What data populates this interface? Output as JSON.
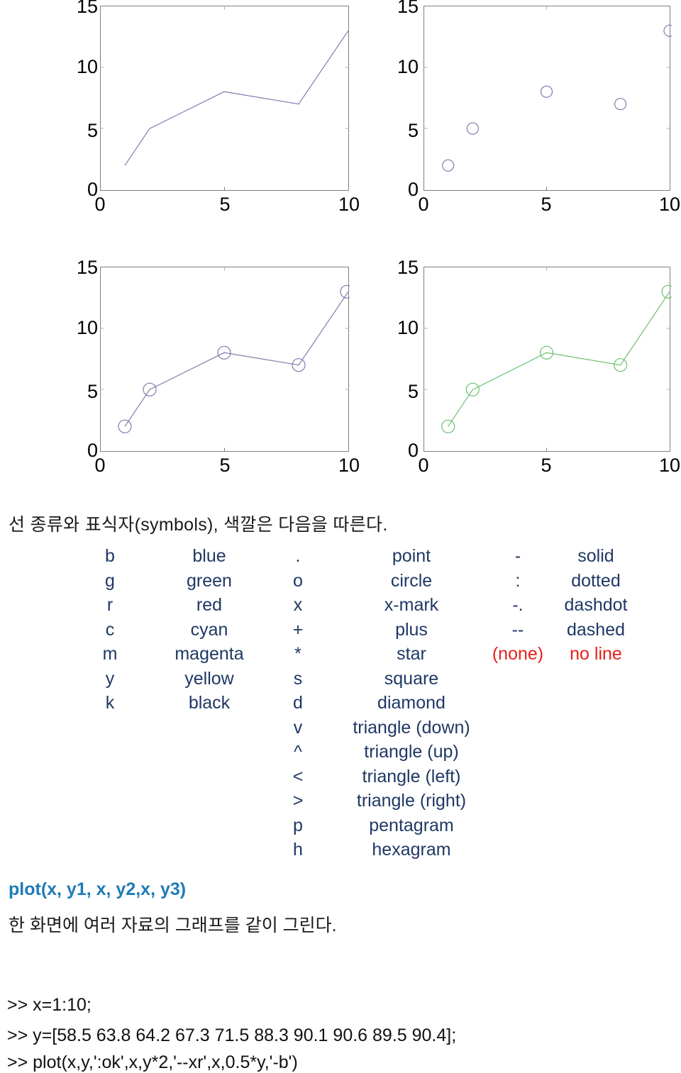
{
  "chart_data": [
    {
      "id": "plot-line-only",
      "type": "line",
      "title": "",
      "xlabel": "",
      "ylabel": "",
      "x": [
        1,
        2,
        5,
        8,
        10
      ],
      "values": [
        2,
        5,
        8,
        7,
        13
      ],
      "xlim": [
        0,
        10
      ],
      "ylim": [
        0,
        15
      ],
      "xticks": [
        "0",
        "5",
        "10"
      ],
      "yticks": [
        "0",
        "5",
        "10",
        "15"
      ],
      "line_style": "solid",
      "marker": "none",
      "color": "#7d7dae",
      "grid": false,
      "legend": "none"
    },
    {
      "id": "plot-marker-only",
      "type": "scatter",
      "title": "",
      "xlabel": "",
      "ylabel": "",
      "x": [
        1,
        2,
        5,
        8,
        10
      ],
      "values": [
        2,
        5,
        8,
        7,
        13
      ],
      "xlim": [
        0,
        10
      ],
      "ylim": [
        0,
        15
      ],
      "xticks": [
        "0",
        "5",
        "10"
      ],
      "yticks": [
        "0",
        "5",
        "10",
        "15"
      ],
      "line_style": "none",
      "marker": "circle",
      "color": "#7d7dae",
      "grid": false,
      "legend": "none"
    },
    {
      "id": "plot-line-marker-blue",
      "type": "line",
      "title": "",
      "xlabel": "",
      "ylabel": "",
      "x": [
        1,
        2,
        5,
        8,
        10
      ],
      "values": [
        2,
        5,
        8,
        7,
        13
      ],
      "xlim": [
        0,
        10
      ],
      "ylim": [
        0,
        15
      ],
      "xticks": [
        "0",
        "5",
        "10"
      ],
      "yticks": [
        "0",
        "5",
        "10",
        "15"
      ],
      "line_style": "solid",
      "marker": "circle",
      "color": "#7d7dae",
      "grid": false,
      "legend": "none"
    },
    {
      "id": "plot-line-marker-green",
      "type": "line",
      "title": "",
      "xlabel": "",
      "ylabel": "",
      "x": [
        1,
        2,
        5,
        8,
        10
      ],
      "values": [
        2,
        5,
        8,
        7,
        13
      ],
      "xlim": [
        0,
        10
      ],
      "ylim": [
        0,
        15
      ],
      "xticks": [
        "0",
        "5",
        "10"
      ],
      "yticks": [
        "0",
        "5",
        "10",
        "15"
      ],
      "line_style": "solid",
      "marker": "circle",
      "color": "#6cc070",
      "grid": false,
      "legend": "none"
    }
  ],
  "axis_labels": {
    "y": [
      "15",
      "10",
      "5",
      "0"
    ],
    "x": [
      "0",
      "5",
      "10"
    ]
  },
  "heading": "선 종류와 표식자(symbols), 색깔은 다음을 따른다.",
  "legend": {
    "rows": [
      {
        "code": "b",
        "name": "blue",
        "sym": ".",
        "symname": "point",
        "ls": "-",
        "lsname": "solid",
        "ls_red": false
      },
      {
        "code": "g",
        "name": "green",
        "sym": "o",
        "symname": "circle",
        "ls": ":",
        "lsname": "dotted",
        "ls_red": false
      },
      {
        "code": "r",
        "name": "red",
        "sym": "x",
        "symname": "x-mark",
        "ls": "-.",
        "lsname": "dashdot",
        "ls_red": false
      },
      {
        "code": "c",
        "name": "cyan",
        "sym": "+",
        "symname": "plus",
        "ls": "--",
        "lsname": "dashed",
        "ls_red": false
      },
      {
        "code": "m",
        "name": "magenta",
        "sym": "*",
        "symname": "star",
        "ls": "(none)",
        "lsname": "no line",
        "ls_red": true
      },
      {
        "code": "y",
        "name": "yellow",
        "sym": "s",
        "symname": "square",
        "ls": "",
        "lsname": "",
        "ls_red": false
      },
      {
        "code": "k",
        "name": "black",
        "sym": "d",
        "symname": "diamond",
        "ls": "",
        "lsname": "",
        "ls_red": false
      },
      {
        "code": "",
        "name": "",
        "sym": "v",
        "symname": "triangle (down)",
        "ls": "",
        "lsname": "",
        "ls_red": false
      },
      {
        "code": "",
        "name": "",
        "sym": "^",
        "symname": "triangle (up)",
        "ls": "",
        "lsname": "",
        "ls_red": false
      },
      {
        "code": "",
        "name": "",
        "sym": "<",
        "symname": "triangle (left)",
        "ls": "",
        "lsname": "",
        "ls_red": false
      },
      {
        "code": "",
        "name": "",
        "sym": ">",
        "symname": "triangle (right)",
        "ls": "",
        "lsname": "",
        "ls_red": false
      },
      {
        "code": "",
        "name": "",
        "sym": "p",
        "symname": "pentagram",
        "ls": "",
        "lsname": "",
        "ls_red": false
      },
      {
        "code": "",
        "name": "",
        "sym": "h",
        "symname": "hexagram",
        "ls": "",
        "lsname": "",
        "ls_red": false
      }
    ]
  },
  "syntax": {
    "call": "plot(x, y1, x, y2,x, y3)",
    "description": "한 화면에 여러 자료의 그래프를 같이 그린다."
  },
  "console": {
    "lines": [
      ">> x=1:10;",
      ">> y=[58.5 63.8 64.2 67.3 71.5 88.3 90.1 90.6 89.5 90.4];",
      ">> plot(x,y,':ok',x,y*2,'--xr',x,0.5*y,'-b')"
    ]
  },
  "colors": {
    "plot_blue": "#7d7dae",
    "plot_green": "#6cc070",
    "legend_text": "#1f3864",
    "legend_red": "#e8201a",
    "call_blue": "#1f7bb6",
    "axis_box": "#808080"
  }
}
